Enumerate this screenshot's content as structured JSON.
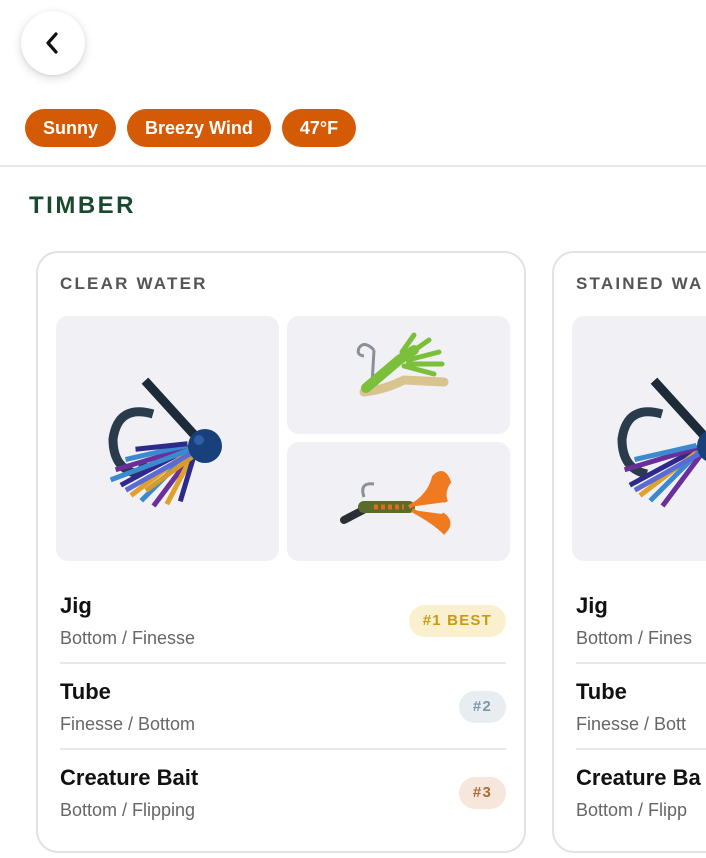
{
  "header": {
    "back_icon": "chevron-left-icon",
    "chips": [
      "Sunny",
      "Breezy Wind",
      "47°F"
    ]
  },
  "section": {
    "title": "TIMBER"
  },
  "cards": [
    {
      "title": "CLEAR WATER",
      "images": [
        "jig-lure-image",
        "tube-lure-image",
        "creature-bait-lure-image"
      ],
      "rows": [
        {
          "name": "Jig",
          "sub": "Bottom / Finesse",
          "badge": "#1 BEST"
        },
        {
          "name": "Tube",
          "sub": "Finesse / Bottom",
          "badge": "#2"
        },
        {
          "name": "Creature Bait",
          "sub": "Bottom / Flipping",
          "badge": "#3"
        }
      ]
    },
    {
      "title": "STAINED WA",
      "rows": [
        {
          "name": "Jig",
          "sub": "Bottom / Fines"
        },
        {
          "name": "Tube",
          "sub": "Finesse / Bott"
        },
        {
          "name": "Creature Ba",
          "sub": "Bottom / Flipp"
        }
      ]
    }
  ],
  "colors": {
    "chip_bg": "#d45a06",
    "section_title": "#1a4a2e",
    "badge_gold": "#c99a14",
    "badge_silver": "#7f95aa",
    "badge_bronze": "#b06a35"
  }
}
